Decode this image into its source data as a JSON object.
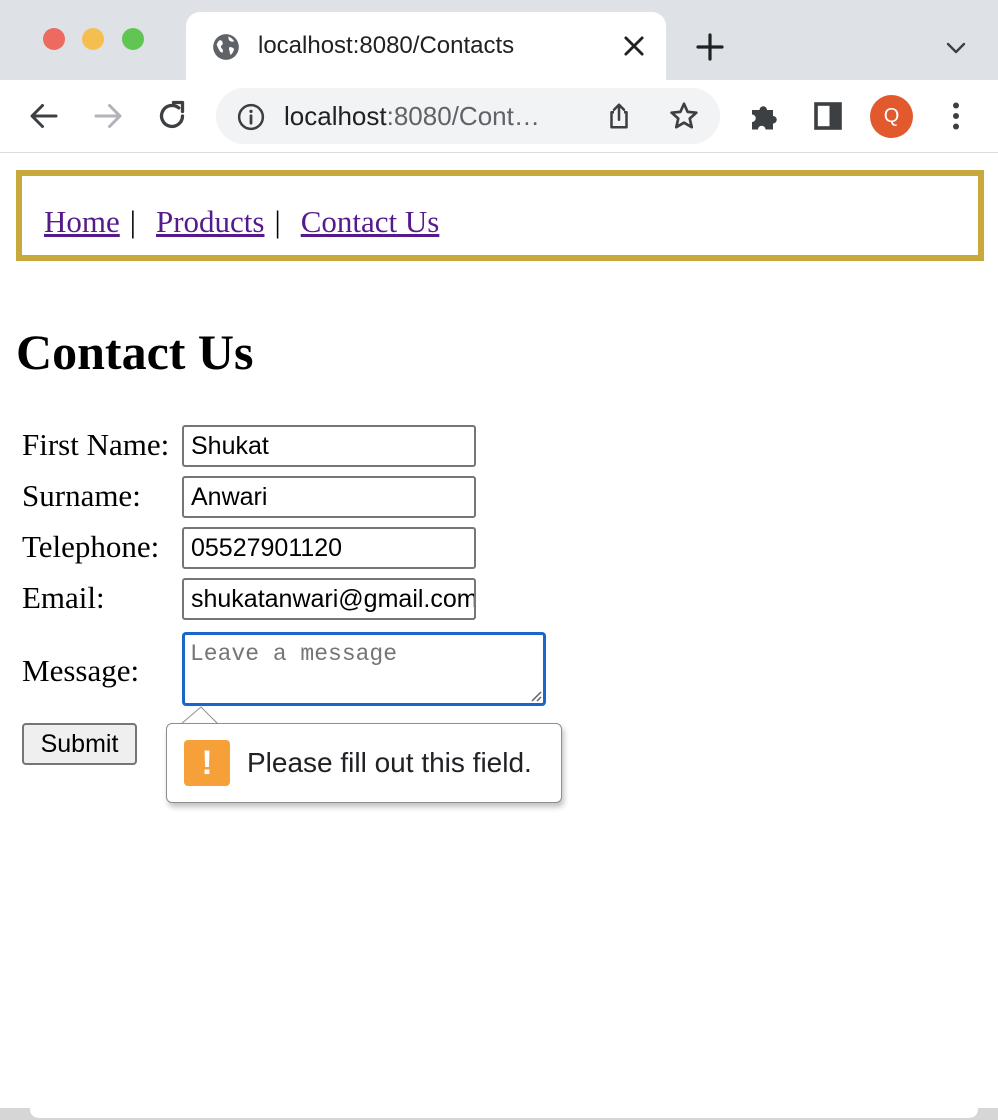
{
  "browser": {
    "tab_title": "localhost:8080/Contacts",
    "url_host": "localhost",
    "url_path": ":8080/Cont…",
    "profile_initial": "Q",
    "profile_color": "#e2592e",
    "icons": [
      "globe-icon",
      "close-icon",
      "plus-icon",
      "chevron-down-icon",
      "back-arrow-icon",
      "forward-arrow-icon",
      "reload-icon",
      "info-icon",
      "share-icon",
      "star-icon",
      "puzzle-icon",
      "sidebar-icon",
      "more-vert-icon"
    ]
  },
  "nav": {
    "border_color": "#c9a93c",
    "links": [
      "Home",
      "Products",
      "Contact Us"
    ],
    "separator": "|"
  },
  "page": {
    "heading": "Contact Us"
  },
  "form": {
    "first_name": {
      "label": "First Name:",
      "value": "Shukat"
    },
    "surname": {
      "label": "Surname:",
      "value": "Anwari"
    },
    "telephone": {
      "label": "Telephone:",
      "value": "05527901120"
    },
    "email": {
      "label": "Email:",
      "value": "shukatanwari@gmail.com"
    },
    "message": {
      "label": "Message:",
      "placeholder": "Leave a message",
      "value": ""
    },
    "submit_label": "Submit"
  },
  "validation": {
    "message": "Please fill out this field.",
    "icon_glyph": "!",
    "icon_color": "#f6a03a"
  }
}
